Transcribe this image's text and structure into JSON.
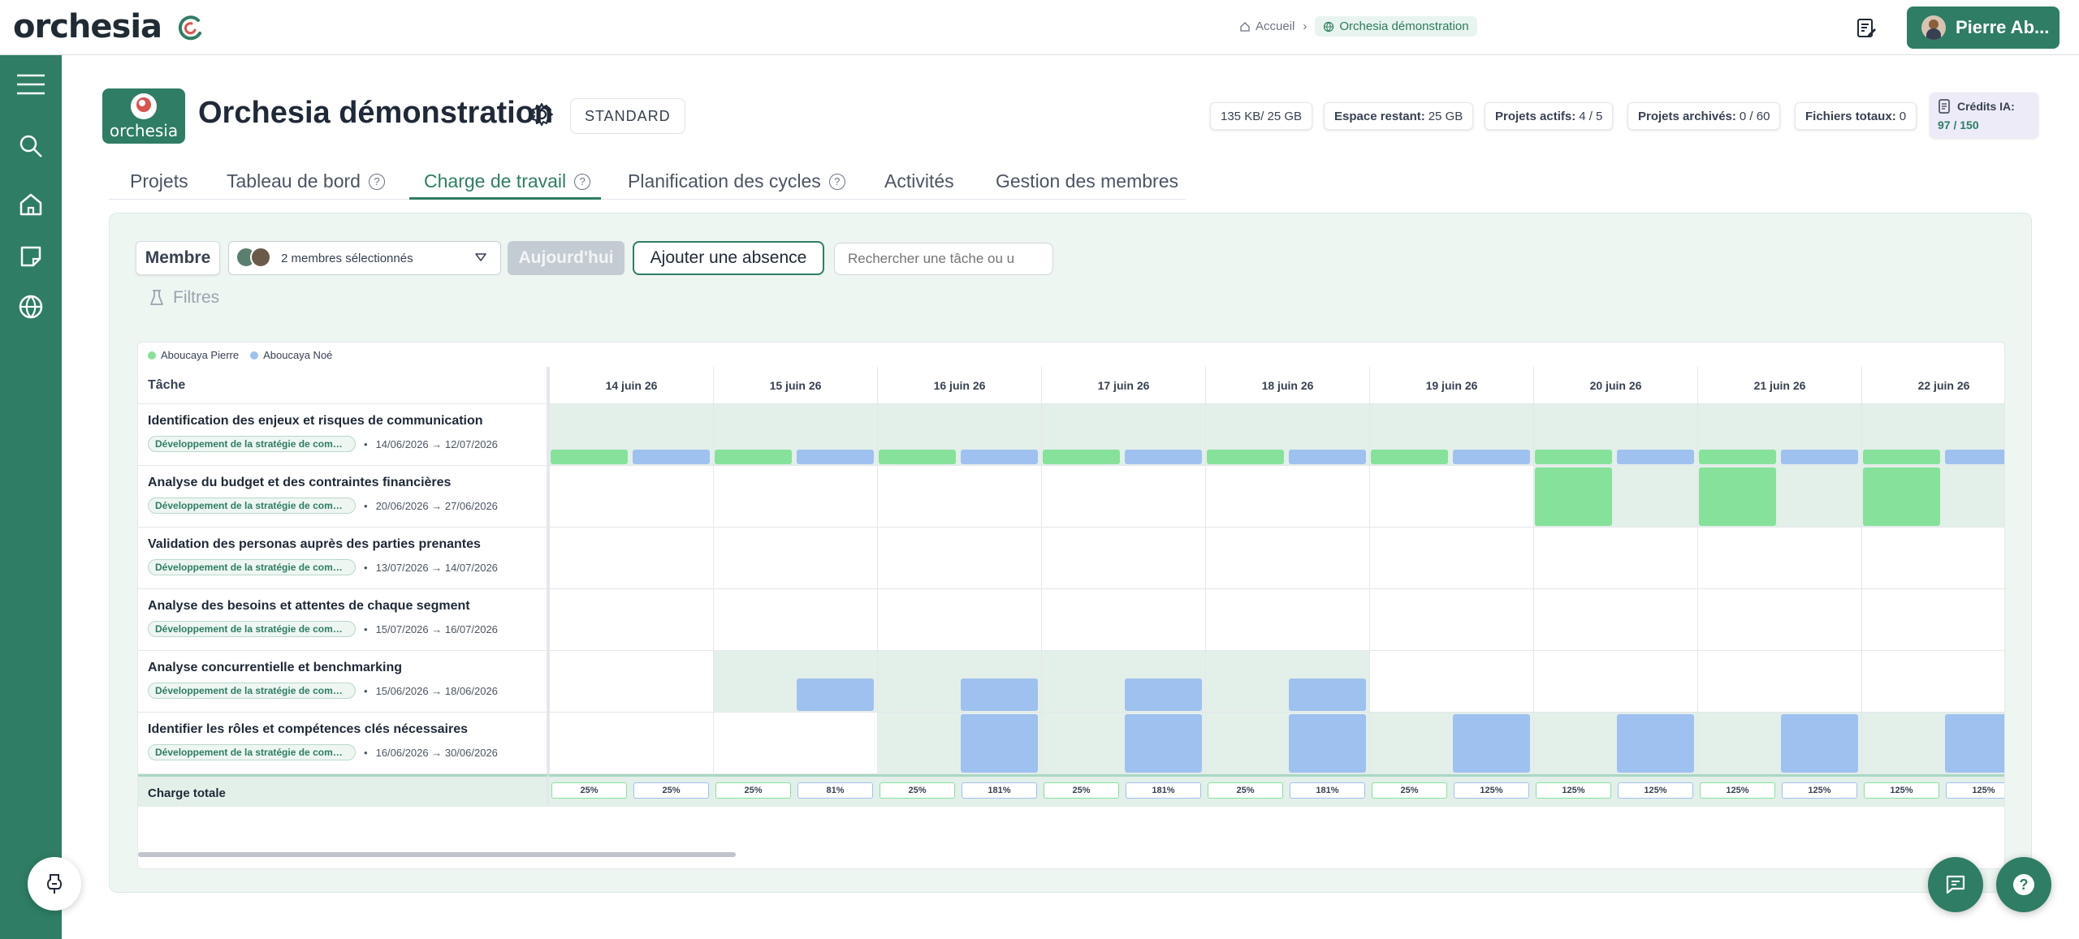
{
  "app": {
    "logo_text": "orchesia",
    "breadcrumb": {
      "home": "Accueil",
      "current": "Orchesia démonstration"
    },
    "user_name": "Pierre Ab...",
    "colors": {
      "brand": "#2e7d64",
      "user_green": "#86e29b",
      "user_blue": "#9fc1ef"
    }
  },
  "sidebar": {
    "items": [
      {
        "icon": "menu-icon"
      },
      {
        "icon": "search-icon"
      },
      {
        "icon": "home-icon"
      },
      {
        "icon": "note-icon"
      },
      {
        "icon": "globe-icon"
      }
    ]
  },
  "header": {
    "org_logo_text": "orchesia",
    "title": "Orchesia démonstration",
    "plan": "STANDARD",
    "stats": [
      {
        "label": "",
        "value": "135 KB/ 25 GB"
      },
      {
        "label": "Espace restant:",
        "value": "25 GB"
      },
      {
        "label": "Projets actifs:",
        "value": "4 / 5"
      },
      {
        "label": "Projets archivés:",
        "value": "0 / 60"
      },
      {
        "label": "Fichiers totaux:",
        "value": "0"
      }
    ],
    "credits": {
      "label": "Crédits IA:",
      "value": "97 / 150"
    }
  },
  "tabs": [
    {
      "label": "Projets",
      "help": false,
      "active": false
    },
    {
      "label": "Tableau de bord",
      "help": true,
      "active": false
    },
    {
      "label": "Charge de travail",
      "help": true,
      "active": true
    },
    {
      "label": "Planification des cycles",
      "help": true,
      "active": false
    },
    {
      "label": "Activités",
      "help": false,
      "active": false
    },
    {
      "label": "Gestion des membres",
      "help": false,
      "active": false
    }
  ],
  "toolbar": {
    "member_button": "Membre",
    "member_select": "2 membres sélectionnés",
    "today_button": "Aujourd'hui",
    "add_absence_button": "Ajouter une absence",
    "search_placeholder": "Rechercher une tâche ou u",
    "filters_label": "Filtres"
  },
  "gantt": {
    "legend": [
      {
        "name": "Aboucaya Pierre",
        "color": "#86e29b"
      },
      {
        "name": "Aboucaya Noé",
        "color": "#9fc1ef"
      }
    ],
    "task_column_label": "Tâche",
    "days": [
      "14 juin 26",
      "15 juin 26",
      "16 juin 26",
      "17 juin 26",
      "18 juin 26",
      "19 juin 26",
      "20 juin 26",
      "21 juin 26",
      "22 juin 26"
    ],
    "tasks": [
      {
        "name": "Identification des enjeux et risques de communication",
        "tag": "Développement de la stratégie de communication",
        "dates": "14/06/2026 → 12/07/2026"
      },
      {
        "name": "Analyse du budget et des contraintes financières",
        "tag": "Développement de la stratégie de communication",
        "dates": "20/06/2026 → 27/06/2026"
      },
      {
        "name": "Validation des personas auprès des parties prenantes",
        "tag": "Développement de la stratégie de communication",
        "dates": "13/07/2026 → 14/07/2026"
      },
      {
        "name": "Analyse des besoins et attentes de chaque segment",
        "tag": "Développement de la stratégie de communication",
        "dates": "15/07/2026 → 16/07/2026"
      },
      {
        "name": "Analyse concurrentielle et benchmarking",
        "tag": "Développement de la stratégie de communication",
        "dates": "15/06/2026 → 18/06/2026"
      },
      {
        "name": "Identifier les rôles et compétences clés nécessaires",
        "tag": "Développement de la stratégie de communication",
        "dates": "16/06/2026 → 30/06/2026"
      }
    ],
    "total_label": "Charge totale",
    "totals": [
      [
        "25%",
        "25%"
      ],
      [
        "25%",
        "81%"
      ],
      [
        "25%",
        "181%"
      ],
      [
        "25%",
        "181%"
      ],
      [
        "25%",
        "181%"
      ],
      [
        "25%",
        "125%"
      ],
      [
        "125%",
        "125%"
      ],
      [
        "125%",
        "125%"
      ],
      [
        "125%",
        "125%"
      ]
    ]
  }
}
